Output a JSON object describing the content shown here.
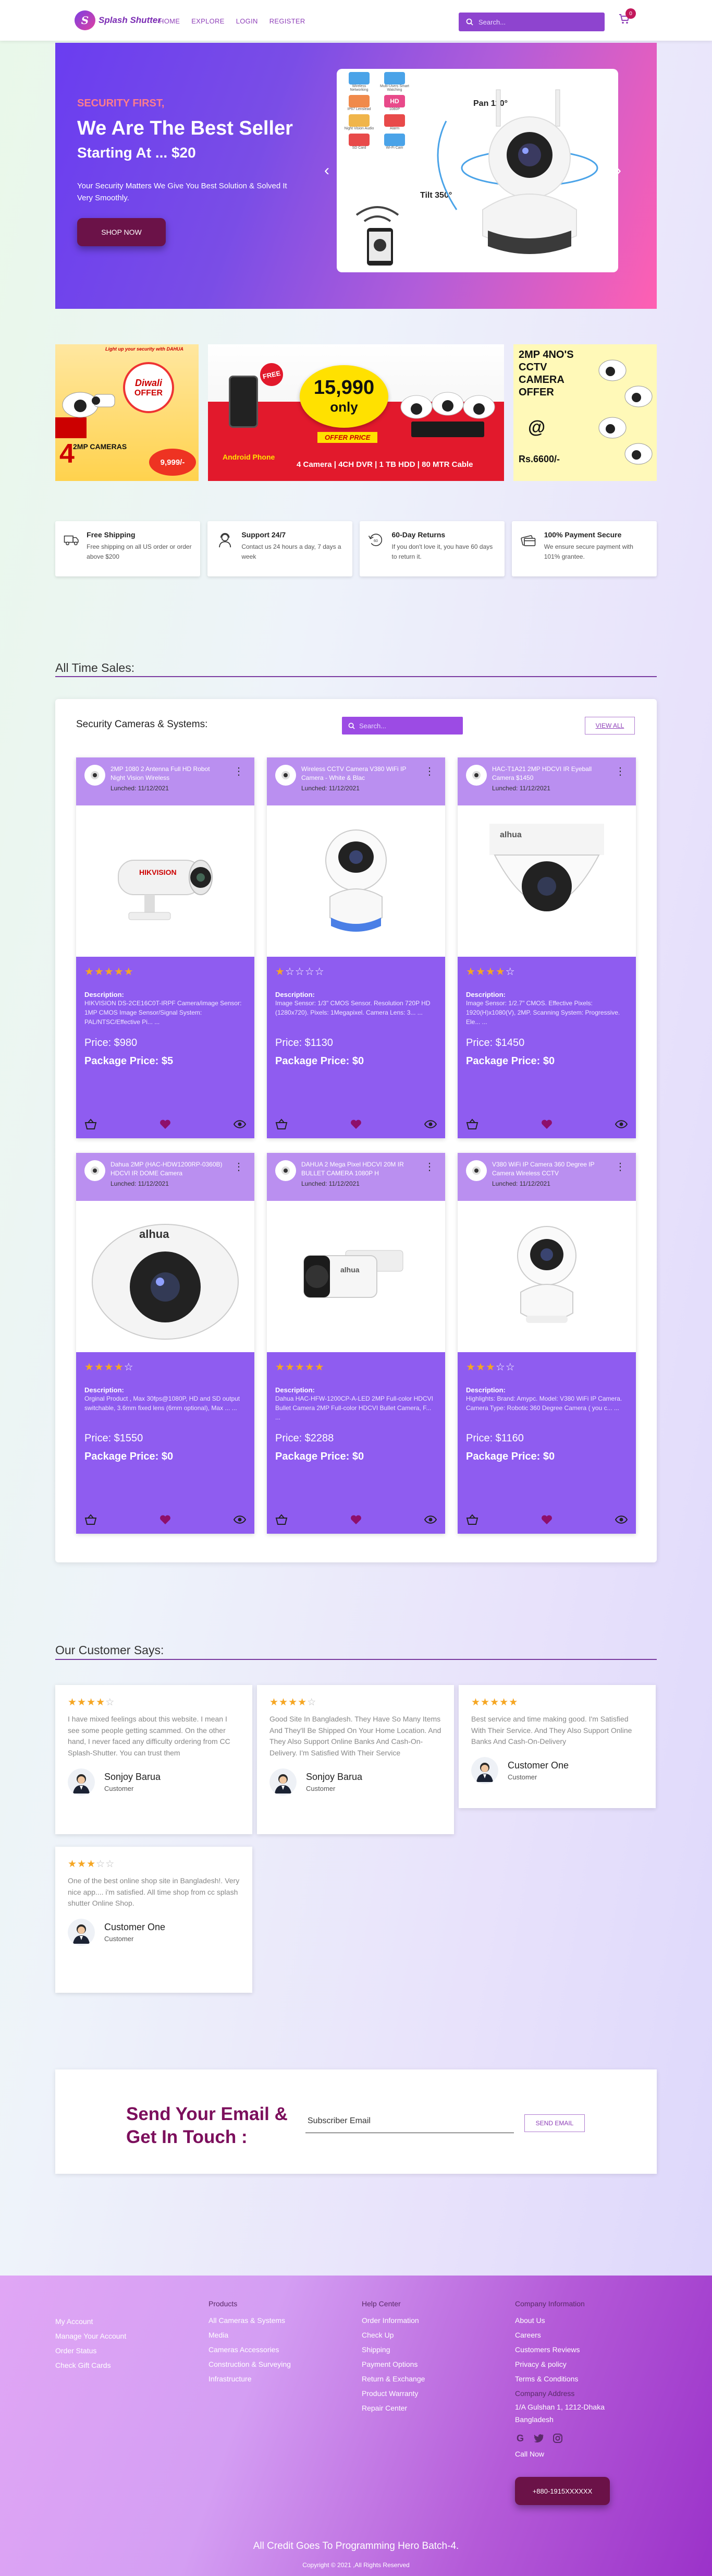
{
  "header": {
    "logo_mark": "S",
    "logo_text": "Splash Shutter",
    "nav": [
      "HOME",
      "EXPLORE",
      "LOGIN",
      "REGISTER"
    ],
    "search_placeholder": "Search...",
    "cart_count": "0"
  },
  "hero": {
    "pre": "SECURITY FIRST,",
    "title1": "We Are The Best Seller",
    "title2": "Starting At ... $20",
    "text": "Your Security Matters We Give You Best Solution & Solved It Very Smoothly.",
    "button": "SHOP NOW",
    "camera_labels": [
      "Pan  110°",
      "Tilt  350°"
    ],
    "feature_icons": [
      "Wireless Networking",
      "Multi-Users Smart Watching",
      "IP67 Lenslead",
      "1080P",
      "Night Vision Audio",
      "Alarm",
      "SD Card",
      "Wi-Fi Cam"
    ]
  },
  "promos": {
    "a": {
      "lines": [
        "Light up your security with DAHUA",
        "Diwali",
        "OFFER",
        "2MP CAMERAS",
        "4",
        "9,999/-"
      ]
    },
    "b": {
      "price": "15,990",
      "only": "only",
      "free": "FREE",
      "phone": "Android Phone",
      "offer": "OFFER PRICE",
      "specs": "4 Camera | 4CH DVR | 1 TB HDD | 80 MTR Cable"
    },
    "c": {
      "lines": [
        "2MP 4NO'S",
        "CCTV",
        "CAMERA",
        "OFFER",
        "@",
        "Rs.6600/-"
      ]
    }
  },
  "features": [
    {
      "icon": "truck-icon",
      "title": "Free Shipping",
      "text": "Free shipping on all US order or order above $200"
    },
    {
      "icon": "support-icon",
      "title": "Support 24/7",
      "text": "Contact us 24 hours a day, 7 days a week"
    },
    {
      "icon": "return-icon",
      "title": "60-Day Returns",
      "text": "If you don't love it, you have 60 days to return it."
    },
    {
      "icon": "payment-icon",
      "title": "100% Payment Secure",
      "text": "We ensure secure payment with 101% grantee."
    }
  ],
  "sales": {
    "section_title": "All Time Sales:",
    "panel_title": "Security Cameras & Systems:",
    "search_placeholder": "Search...",
    "view_all": "VIEW ALL",
    "desc_label": "Description:",
    "products": [
      {
        "title": "2MP 1080 2 Antenna Full HD Robot Night Vision Wireless",
        "date": "Lunched: 11/12/2021",
        "rating": 5,
        "desc": "HIKVISION DS-2CE16C0T-IRPF Camera/image Sensor: 1MP CMOS Image Sensor/Signal System: PAL/NTSC/Effective Pi... ...",
        "price": "Price: $980",
        "package": "Package Price: $5",
        "img": "bullet"
      },
      {
        "title": "Wireless CCTV Camera V380 WiFi IP Camera - White & Blac",
        "date": "Lunched: 11/12/2021",
        "rating": 1,
        "desc": "Image Sensor: 1/3\" CMOS Sensor. Resolution 720P HD (1280x720). Pixels: 1Megapixel. Camera Lens: 3... ...",
        "price": "Price: $1130",
        "package": "Package Price: $0",
        "img": "ptz-white"
      },
      {
        "title": "HAC-T1A21 2MP HDCVI IR Eyeball Camera $1450",
        "date": "Lunched: 11/12/2021",
        "rating": 4,
        "desc": "Image Sensor: 1/2.7\" CMOS. Effective Pixels: 1920(H)x1080(V), 2MP. Scanning System: Progressive. Ele... ...",
        "price": "Price: $1450",
        "package": "Package Price: $0",
        "img": "dome"
      },
      {
        "title": "Dahua 2MP (HAC-HDW1200RP-0360B) HDCVI IR DOME Camera",
        "date": "Lunched: 11/12/2021",
        "rating": 4,
        "desc": "Orginal Product , Max 30fps@1080P, HD and SD output switchable, 3.6mm fixed lens (6mm optional), Max ... ...",
        "price": "Price: $1550",
        "package": "Package Price: $0",
        "img": "dome-big"
      },
      {
        "title": "DAHUA 2 Mega Pixel HDCVI 20M IR BULLET CAMERA 1080P H",
        "date": "Lunched: 11/12/2021",
        "rating": 5,
        "desc": "Dahua HAC-HFW-1200CP-A-LED 2MP Full-color HDCVI Bullet Camera 2MP Full-color HDCVI Bullet Camera, F... ...",
        "price": "Price: $2288",
        "package": "Package Price: $0",
        "img": "bullet-black"
      },
      {
        "title": "V380 WiFi IP Camera 360 Degree IP Camera Wireless CCTV",
        "date": "Lunched: 11/12/2021",
        "rating": 3,
        "desc": "Highlights: Brand: Amypc. Model: V380 WiFi IP Camera. Camera Type: Robotic 360 Degree Camera ( you c... ...",
        "price": "Price: $1160",
        "package": "Package Price: $0",
        "img": "ptz-small"
      }
    ]
  },
  "reviews": {
    "section_title": "Our Customer Says:",
    "items": [
      {
        "rating": 4,
        "text": "I have mixed feelings about this website. I mean I see some people getting scammed. On the other hand, I never faced any difficulty ordering from CC Splash-Shutter. You can trust them",
        "name": "Sonjoy Barua",
        "role": "Customer"
      },
      {
        "rating": 4,
        "text": "Good Site In Bangladesh. They Have So Many Items And They'll Be Shipped On Your Home Location. And They Also Support Online Banks And Cash-On-Delivery. I'm Satisfied With Their Service",
        "name": "Sonjoy Barua",
        "role": "Customer"
      },
      {
        "rating": 5,
        "text": "Best service and time making good. I'm Satisfied With Their Service. And They Also Support Online Banks And Cash-On-Delivery",
        "name": "Customer One",
        "role": "Customer"
      },
      {
        "rating": 3,
        "text": "One of the best online shop site in Bangladesh!. Very nice app.... i'm satisfied. All time shop from cc splash shutter Online Shop.",
        "name": "Customer One",
        "role": "Customer"
      }
    ]
  },
  "newsletter": {
    "title1": "Send Your Email &",
    "title2": "Get In Touch :",
    "placeholder": "Subscriber Email",
    "button": "SEND EMAIL"
  },
  "footer": {
    "col1": {
      "links": [
        "My Account",
        "Manage Your Account",
        "Order Status",
        "Check Gift Cards"
      ]
    },
    "col2": {
      "heading": "Products",
      "links": [
        "All Cameras & Systems",
        "Media",
        "Cameras Accessories",
        "Construction & Surveying",
        "Infrastructure"
      ]
    },
    "col3": {
      "heading": "Help Center",
      "links": [
        "Order Information",
        "Check Up",
        "Shipping",
        "Payment Options",
        "Return & Exchange",
        "Product Warranty",
        "Repair Center"
      ]
    },
    "col4": {
      "heading": "Company Information",
      "links": [
        "About Us",
        "Careers",
        "Customers Reviews",
        "Privacy & policy",
        "Terms & Conditions"
      ],
      "address_label": "Company Address",
      "address": "1/A Gulshan 1, 1212-Dhaka Bangladesh",
      "call_label": "Call Now",
      "phone": "+880-1915XXXXXX"
    },
    "credit": "All Credit Goes To Programming Hero Batch-4.",
    "copyright": "Copyright © 2021 ,All Rights Reserved"
  }
}
